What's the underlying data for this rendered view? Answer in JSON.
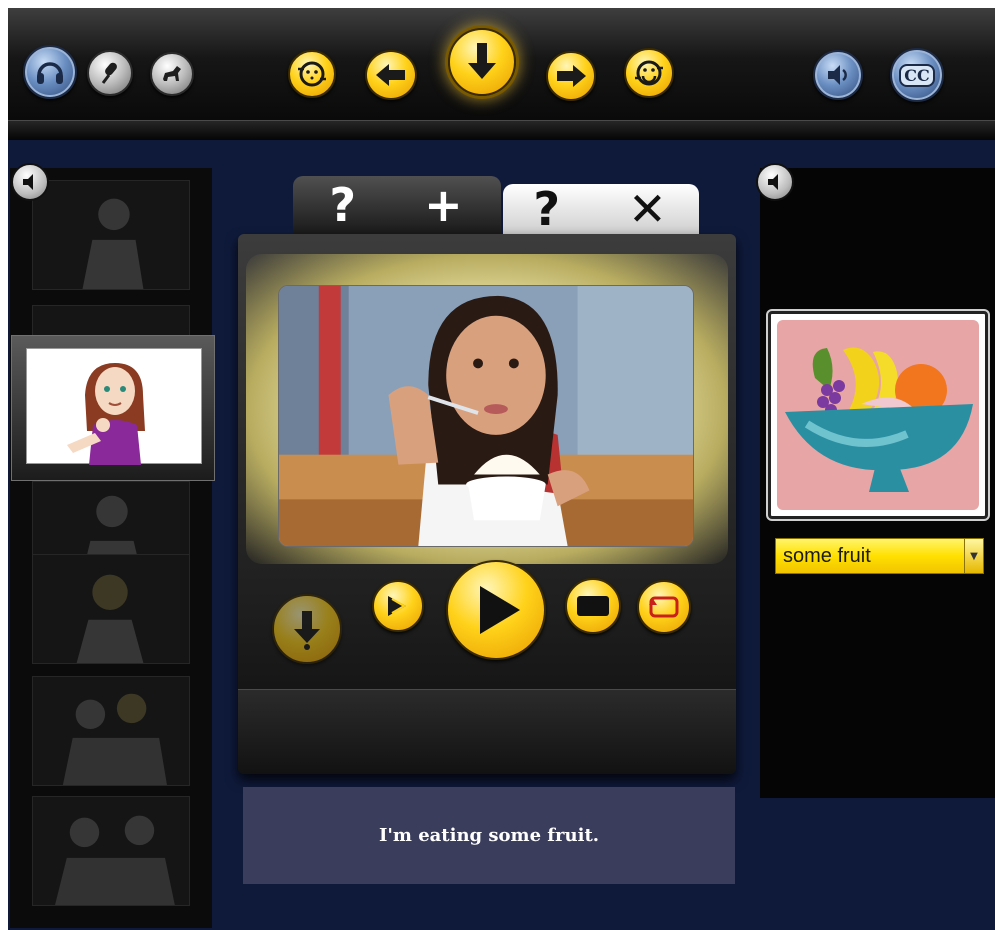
{
  "toolbar": {
    "left_icons": [
      "headphones-icon",
      "microphone-icon",
      "horse-icon"
    ],
    "center_icons": [
      "smile-face-icon",
      "left-arrow-icon",
      "down-arrow-icon",
      "right-arrow-icon",
      "replay-face-icon"
    ],
    "right_icons": [
      "speaker-icon",
      "closed-caption-icon"
    ],
    "cc_label": "CC"
  },
  "tabs": {
    "add_label": "? +",
    "remove_label": "? ✕"
  },
  "player": {
    "controls": [
      "download-icon",
      "fast-forward-icon",
      "play-icon",
      "stop-icon",
      "loop-icon"
    ]
  },
  "vocab": {
    "selected_word": "some fruit"
  },
  "caption": {
    "text": "I'm eating some fruit."
  },
  "colors": {
    "background": "#0f1a3b",
    "gold": "#ffd21a",
    "caption_bg": "#3a3d5c",
    "dropdown": "#ffe000"
  }
}
